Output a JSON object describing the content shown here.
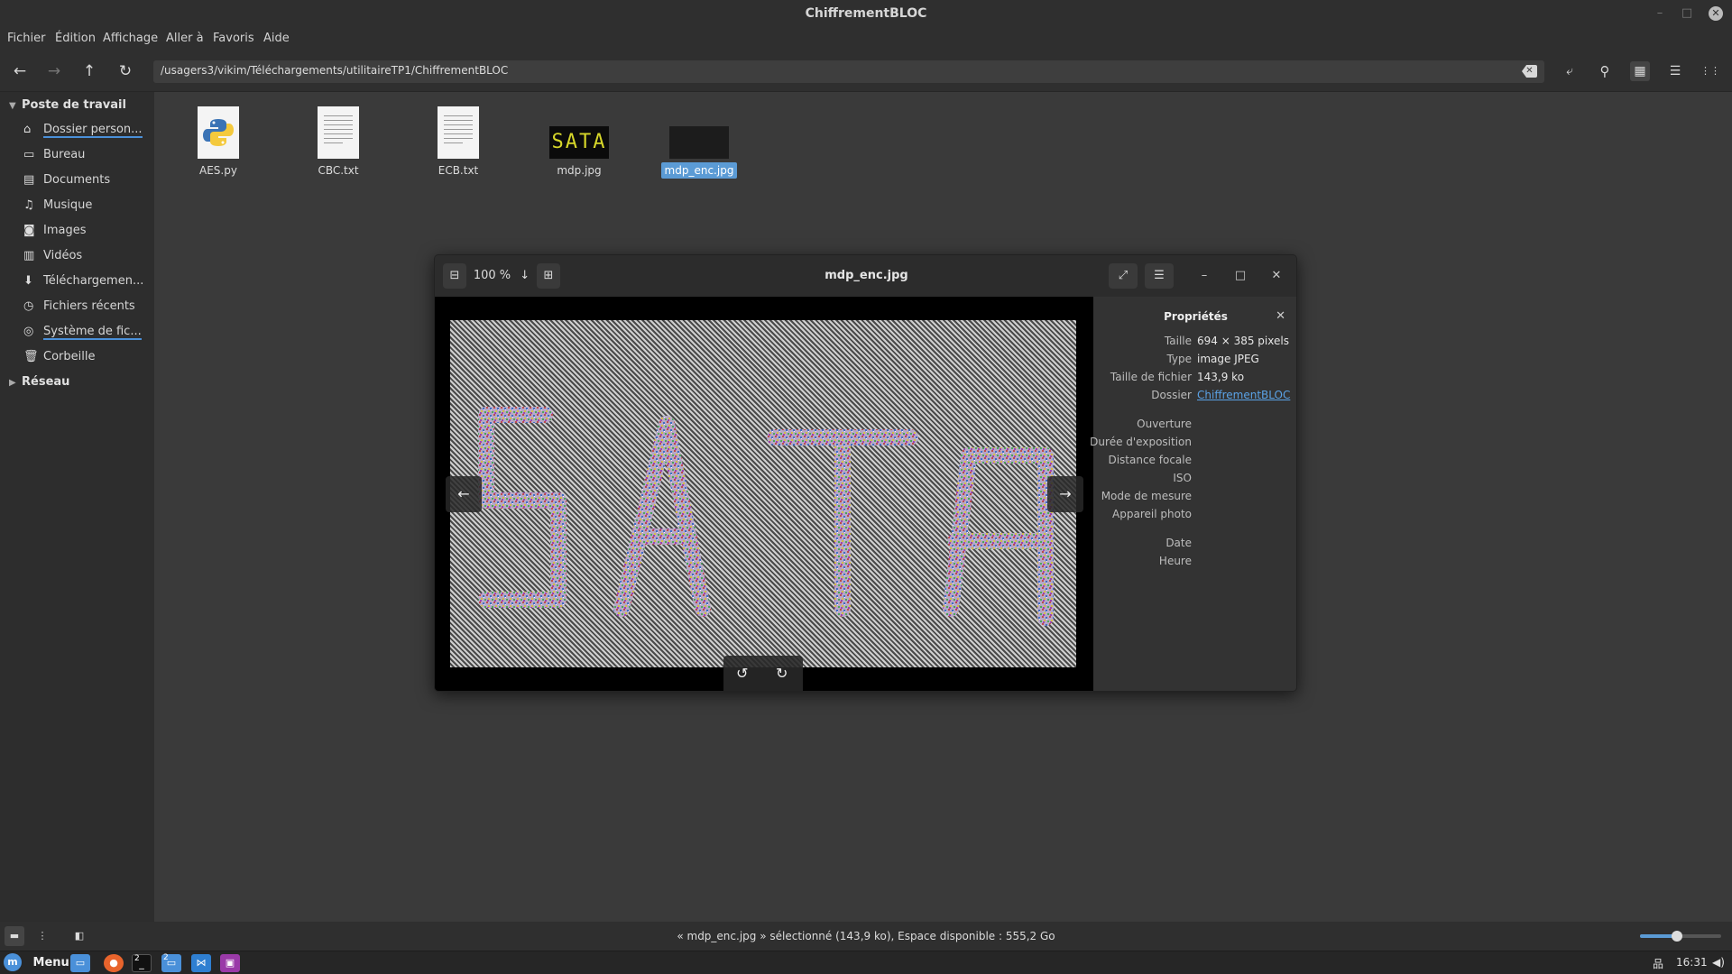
{
  "window": {
    "title": "ChiffrementBLOC",
    "controls": {
      "minimize": "–",
      "maximize": "□",
      "close": "✕"
    }
  },
  "menubar": [
    "Fichier",
    "Édition",
    "Affichage",
    "Aller à",
    "Favoris",
    "Aide"
  ],
  "toolbar": {
    "back_icon": "←",
    "forward_icon": "→",
    "up_icon": "↑",
    "reload_icon": "↻",
    "path": "/usagers3/vikim/Téléchargements/utilitaireTP1/ChiffrementBLOC",
    "clear_icon": "✕",
    "toggle_location_icon": "⤶",
    "search_icon": "⚲",
    "icon_view_icon": "▦",
    "list_view_icon": "☰",
    "compact_view_icon": "⋮⋮"
  },
  "sidebar": {
    "computer_header": "Poste de travail",
    "network_header": "Réseau",
    "items": [
      {
        "label": "Dossier person...",
        "icon": "⌂"
      },
      {
        "label": "Bureau",
        "icon": "▭"
      },
      {
        "label": "Documents",
        "icon": "▤"
      },
      {
        "label": "Musique",
        "icon": "♫"
      },
      {
        "label": "Images",
        "icon": "◙"
      },
      {
        "label": "Vidéos",
        "icon": "▥"
      },
      {
        "label": "Téléchargemen...",
        "icon": "⬇"
      },
      {
        "label": "Fichiers récents",
        "icon": "◷"
      },
      {
        "label": "Système de fic...",
        "icon": "◎"
      },
      {
        "label": "Corbeille",
        "icon": "🗑"
      }
    ]
  },
  "files": [
    {
      "name": "AES.py",
      "kind": "python"
    },
    {
      "name": "CBC.txt",
      "kind": "text"
    },
    {
      "name": "ECB.txt",
      "kind": "text"
    },
    {
      "name": "mdp.jpg",
      "kind": "image",
      "thumb_text": "SATA"
    },
    {
      "name": "mdp_enc.jpg",
      "kind": "image-encrypted",
      "selected": true
    }
  ],
  "viewer": {
    "title": "mdp_enc.jpg",
    "zoom": "100 %",
    "zoom_out_icon": "⊟",
    "zoom_menu_icon": "↓",
    "zoom_in_icon": "⊞",
    "fullscreen_icon": "⤢",
    "menu_icon": "☰",
    "minimize": "–",
    "maximize": "□",
    "close": "✕",
    "prev_icon": "←",
    "next_icon": "→",
    "rotate_left_icon": "↺",
    "rotate_right_icon": "↻",
    "properties": {
      "title": "Propriétés",
      "close": "✕",
      "rows": [
        {
          "key": "Taille",
          "value": "694 × 385 pixels"
        },
        {
          "key": "Type",
          "value": "image JPEG"
        },
        {
          "key": "Taille de fichier",
          "value": "143,9 ko"
        },
        {
          "key": "Dossier",
          "value": "ChiffrementBLOC",
          "link": true
        }
      ],
      "exif": [
        "Ouverture",
        "Durée d'exposition",
        "Distance focale",
        "ISO",
        "Mode de mesure",
        "Appareil photo"
      ],
      "datetime": [
        "Date",
        "Heure"
      ]
    }
  },
  "statusbar": {
    "text": "« mdp_enc.jpg » sélectionné (143,9 ko), Espace disponible : 555,2 Go",
    "zoom_level": 0.45
  },
  "taskbar": {
    "menu_label": "Menu",
    "time": "16:31",
    "terminal_count": "2",
    "files_count": "2"
  },
  "colors": {
    "accent": "#5b9bd5",
    "background": "#3a3a3a",
    "panel": "#2f2f2f"
  }
}
